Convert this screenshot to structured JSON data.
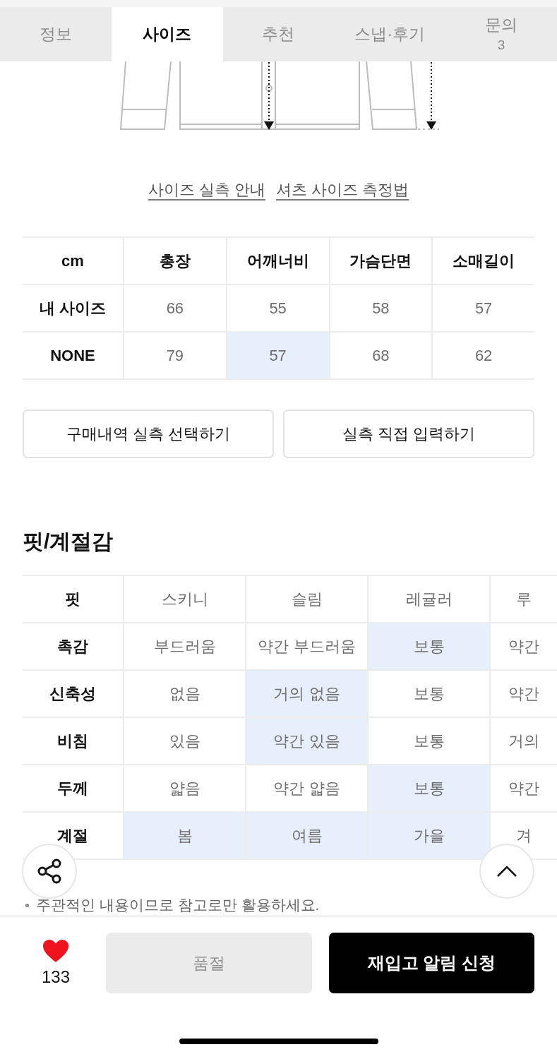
{
  "tabs": [
    {
      "label": "정보",
      "selected": false
    },
    {
      "label": "사이즈",
      "selected": true
    },
    {
      "label": "추천",
      "selected": false
    },
    {
      "label": "스냅·후기",
      "selected": false
    },
    {
      "label": "문의",
      "count": "3",
      "selected": false
    }
  ],
  "size_links": [
    "사이즈 실측 안내",
    "셔츠 사이즈 측정법"
  ],
  "size_table": {
    "unit": "cm",
    "columns": [
      "총장",
      "어깨너비",
      "가슴단면",
      "소매길이"
    ],
    "rows": [
      {
        "label": "내 사이즈",
        "cells": [
          {
            "value": "66",
            "highlighted": false
          },
          {
            "value": "55",
            "highlighted": false
          },
          {
            "value": "58",
            "highlighted": false
          },
          {
            "value": "57",
            "highlighted": false
          }
        ]
      },
      {
        "label": "NONE",
        "cells": [
          {
            "value": "79",
            "highlighted": false
          },
          {
            "value": "57",
            "highlighted": true
          },
          {
            "value": "68",
            "highlighted": false
          },
          {
            "value": "62",
            "highlighted": false
          }
        ]
      }
    ]
  },
  "size_buttons": [
    "구매내역 실측 선택하기",
    "실측 직접 입력하기"
  ],
  "fit_section": {
    "title": "핏/계절감",
    "rows": [
      {
        "label": "핏",
        "options": [
          {
            "text": "스키니",
            "highlighted": false
          },
          {
            "text": "슬림",
            "highlighted": false
          },
          {
            "text": "레귤러",
            "highlighted": false
          },
          {
            "text": "루",
            "highlighted": false
          }
        ]
      },
      {
        "label": "촉감",
        "options": [
          {
            "text": "부드러움",
            "highlighted": false
          },
          {
            "text": "약간 부드러움",
            "highlighted": false
          },
          {
            "text": "보통",
            "highlighted": true
          },
          {
            "text": "약간",
            "highlighted": false
          }
        ]
      },
      {
        "label": "신축성",
        "options": [
          {
            "text": "없음",
            "highlighted": false
          },
          {
            "text": "거의 없음",
            "highlighted": true
          },
          {
            "text": "보통",
            "highlighted": false
          },
          {
            "text": "약간",
            "highlighted": false
          }
        ]
      },
      {
        "label": "비침",
        "options": [
          {
            "text": "있음",
            "highlighted": false
          },
          {
            "text": "약간 있음",
            "highlighted": true
          },
          {
            "text": "보통",
            "highlighted": false
          },
          {
            "text": "거의",
            "highlighted": false
          }
        ]
      },
      {
        "label": "두께",
        "options": [
          {
            "text": "얇음",
            "highlighted": false
          },
          {
            "text": "약간 얇음",
            "highlighted": false
          },
          {
            "text": "보통",
            "highlighted": true
          },
          {
            "text": "약간",
            "highlighted": false
          }
        ]
      },
      {
        "label": "계절",
        "options": [
          {
            "text": "봄",
            "highlighted": true
          },
          {
            "text": "여름",
            "highlighted": true
          },
          {
            "text": "가을",
            "highlighted": true
          },
          {
            "text": "겨",
            "highlighted": false
          }
        ]
      }
    ],
    "note": "주관적인 내용이므로 참고로만 활용하세요."
  },
  "bottom_bar": {
    "likes": "133",
    "liked": true,
    "sold_out_button": {
      "label": "품절",
      "disabled": true
    },
    "restock_button": "재입고 알림 신청"
  }
}
